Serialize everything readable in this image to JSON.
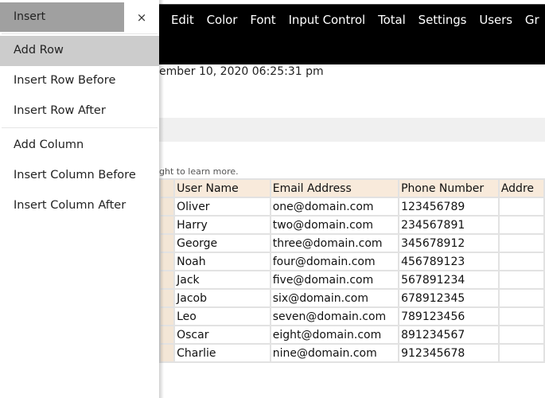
{
  "topbar": {
    "menu": [
      "Edit",
      "Color",
      "Font",
      "Input Control",
      "Total",
      "Settings",
      "Users",
      "Gr"
    ]
  },
  "date_text": "ember 10, 2020 06:25:31 pm",
  "hint_text": "ght to learn more.",
  "table": {
    "headers": [
      "User Name",
      "Email Address",
      "Phone Number",
      "Addre"
    ],
    "rows": [
      [
        "Oliver",
        "one@domain.com",
        "123456789",
        ""
      ],
      [
        "Harry",
        "two@domain.com",
        "234567891",
        ""
      ],
      [
        "George",
        "three@domain.com",
        "345678912",
        ""
      ],
      [
        "Noah",
        "four@domain.com",
        "456789123",
        ""
      ],
      [
        "Jack",
        "five@domain.com",
        "567891234",
        ""
      ],
      [
        "Jacob",
        "six@domain.com",
        "678912345",
        ""
      ],
      [
        "Leo",
        "seven@domain.com",
        "789123456",
        ""
      ],
      [
        "Oscar",
        "eight@domain.com",
        "891234567",
        ""
      ],
      [
        "Charlie",
        "nine@domain.com",
        "912345678",
        ""
      ]
    ]
  },
  "sidebar": {
    "title": "Insert",
    "close_icon": "×",
    "items": [
      {
        "label": "Add Row",
        "active": true
      },
      {
        "label": "Insert Row Before"
      },
      {
        "label": "Insert Row After"
      },
      {
        "label": "Add Column"
      },
      {
        "label": "Insert Column Before"
      },
      {
        "label": "Insert Column After"
      }
    ]
  },
  "colors": {
    "topbar_bg": "#000000",
    "header_cell_bg": "#f8eadb",
    "active_item_bg": "#cccccc",
    "sidebar_head_bg": "#a0a0a0"
  }
}
